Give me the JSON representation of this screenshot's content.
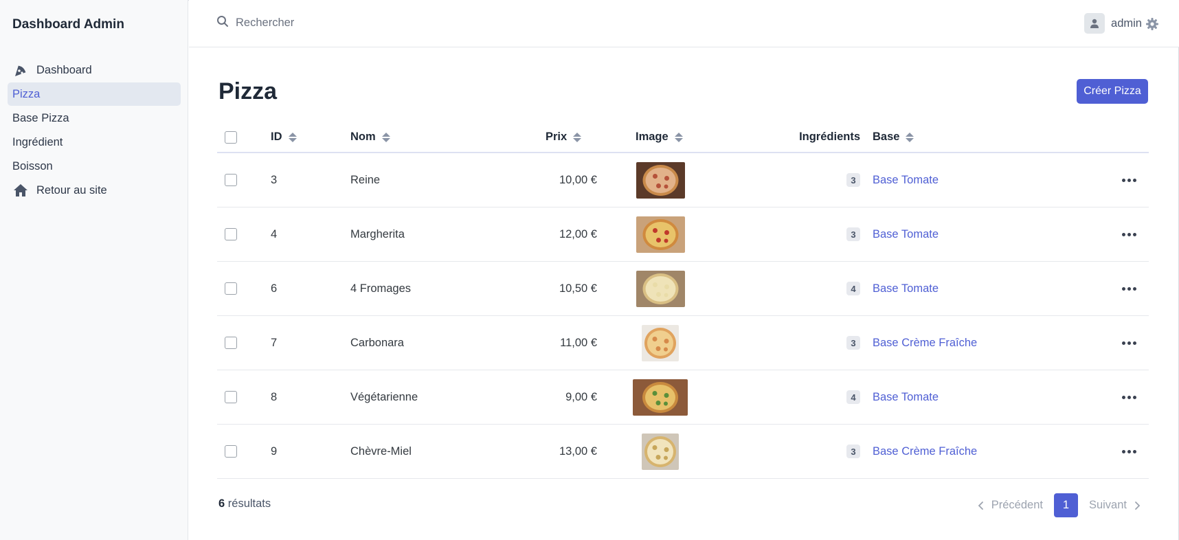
{
  "app": {
    "brand": "Dashboard Admin"
  },
  "sidebar": {
    "items": [
      {
        "label": "Dashboard",
        "icon": "pizza-slice-icon"
      },
      {
        "label": "Pizza"
      },
      {
        "label": "Base Pizza"
      },
      {
        "label": "Ingrédient"
      },
      {
        "label": "Boisson"
      },
      {
        "label": "Retour au site",
        "icon": "home-icon"
      }
    ],
    "active": "Pizza"
  },
  "search": {
    "placeholder": "Rechercher"
  },
  "user": {
    "name": "admin"
  },
  "page": {
    "title": "Pizza",
    "create_label": "Créer Pizza"
  },
  "table": {
    "columns": {
      "id": "ID",
      "name": "Nom",
      "price": "Prix",
      "image": "Image",
      "ingredients": "Ingrédients",
      "base": "Base"
    },
    "rows": [
      {
        "id": "3",
        "name": "Reine",
        "price": "10,00 €",
        "ingredients": "3",
        "base": "Base Tomate"
      },
      {
        "id": "4",
        "name": "Margherita",
        "price": "12,00 €",
        "ingredients": "3",
        "base": "Base Tomate"
      },
      {
        "id": "6",
        "name": "4 Fromages",
        "price": "10,50 €",
        "ingredients": "4",
        "base": "Base Tomate"
      },
      {
        "id": "7",
        "name": "Carbonara",
        "price": "11,00 €",
        "ingredients": "3",
        "base": "Base Crème Fraîche"
      },
      {
        "id": "8",
        "name": "Végétarienne",
        "price": "9,00 €",
        "ingredients": "4",
        "base": "Base Tomate"
      },
      {
        "id": "9",
        "name": "Chèvre-Miel",
        "price": "13,00 €",
        "ingredients": "3",
        "base": "Base Crème Fraîche"
      }
    ]
  },
  "footer": {
    "count": "6",
    "count_suffix": " résultats",
    "prev": "Précédent",
    "page": "1",
    "next": "Suivant"
  },
  "colors": {
    "accent": "#4f5fd4",
    "sidebar_bg": "#f8f9fa",
    "active_bg": "#e3e8f0"
  }
}
